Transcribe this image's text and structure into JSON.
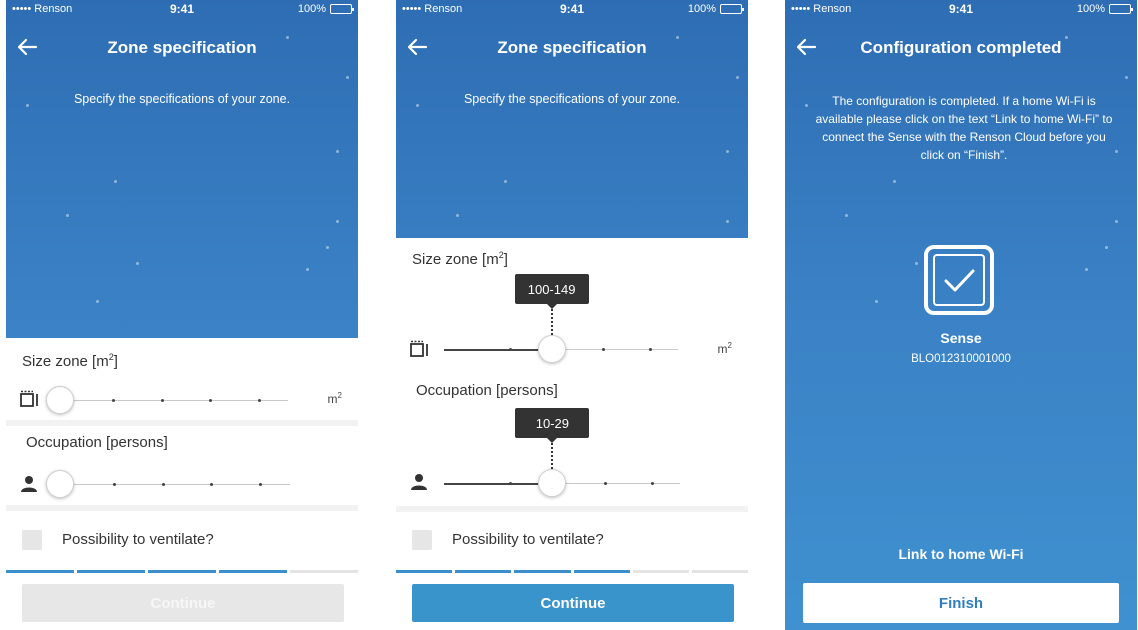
{
  "status_bar": {
    "carrier": "••••• Renson",
    "time": "9:41",
    "battery": "100%"
  },
  "zone_screen": {
    "title": "Zone specification",
    "subtitle": "Specify  the specifications of your zone.",
    "size_label": "Size zone [m",
    "size_label_sup": "2",
    "size_label_end": "]",
    "occupation_label": "Occupation [persons]",
    "unit_main": "m",
    "unit_sup": "2",
    "ventilate_label": "Possibility to ventilate?",
    "continue_label": "Continue"
  },
  "screen1": {
    "size_slider": {
      "level": 0,
      "steps": 5
    },
    "occupation_slider": {
      "level": 0,
      "steps": 5
    },
    "progress": {
      "filled": 4,
      "total": 5
    },
    "continue_enabled": false
  },
  "screen2": {
    "size_slider": {
      "level": 0.4,
      "steps": 5,
      "tooltip": "100-149"
    },
    "occupation_slider": {
      "level": 0.4,
      "steps": 5,
      "tooltip": "10-29"
    },
    "progress": {
      "filled": 4,
      "total": 6
    },
    "continue_enabled": true
  },
  "config_screen": {
    "title": "Configuration completed",
    "description": "The configuration is completed. If a home Wi-Fi is available please click on the text “Link to home Wi-Fi” to connect the Sense with the Renson Cloud before you click on “Finish”.",
    "device_name": "Sense",
    "device_id": "BLO012310001000",
    "link_wifi_label": "Link to home Wi-Fi",
    "finish_label": "Finish"
  },
  "colors": {
    "background_top": "#2e6db3",
    "background_bottom": "#3f91d0",
    "accent": "#3a94cc",
    "tooltip": "#333333"
  },
  "icons": {
    "back": "arrow-left-icon",
    "size": "room-size-icon",
    "person": "person-icon",
    "check": "checkmark-icon"
  }
}
